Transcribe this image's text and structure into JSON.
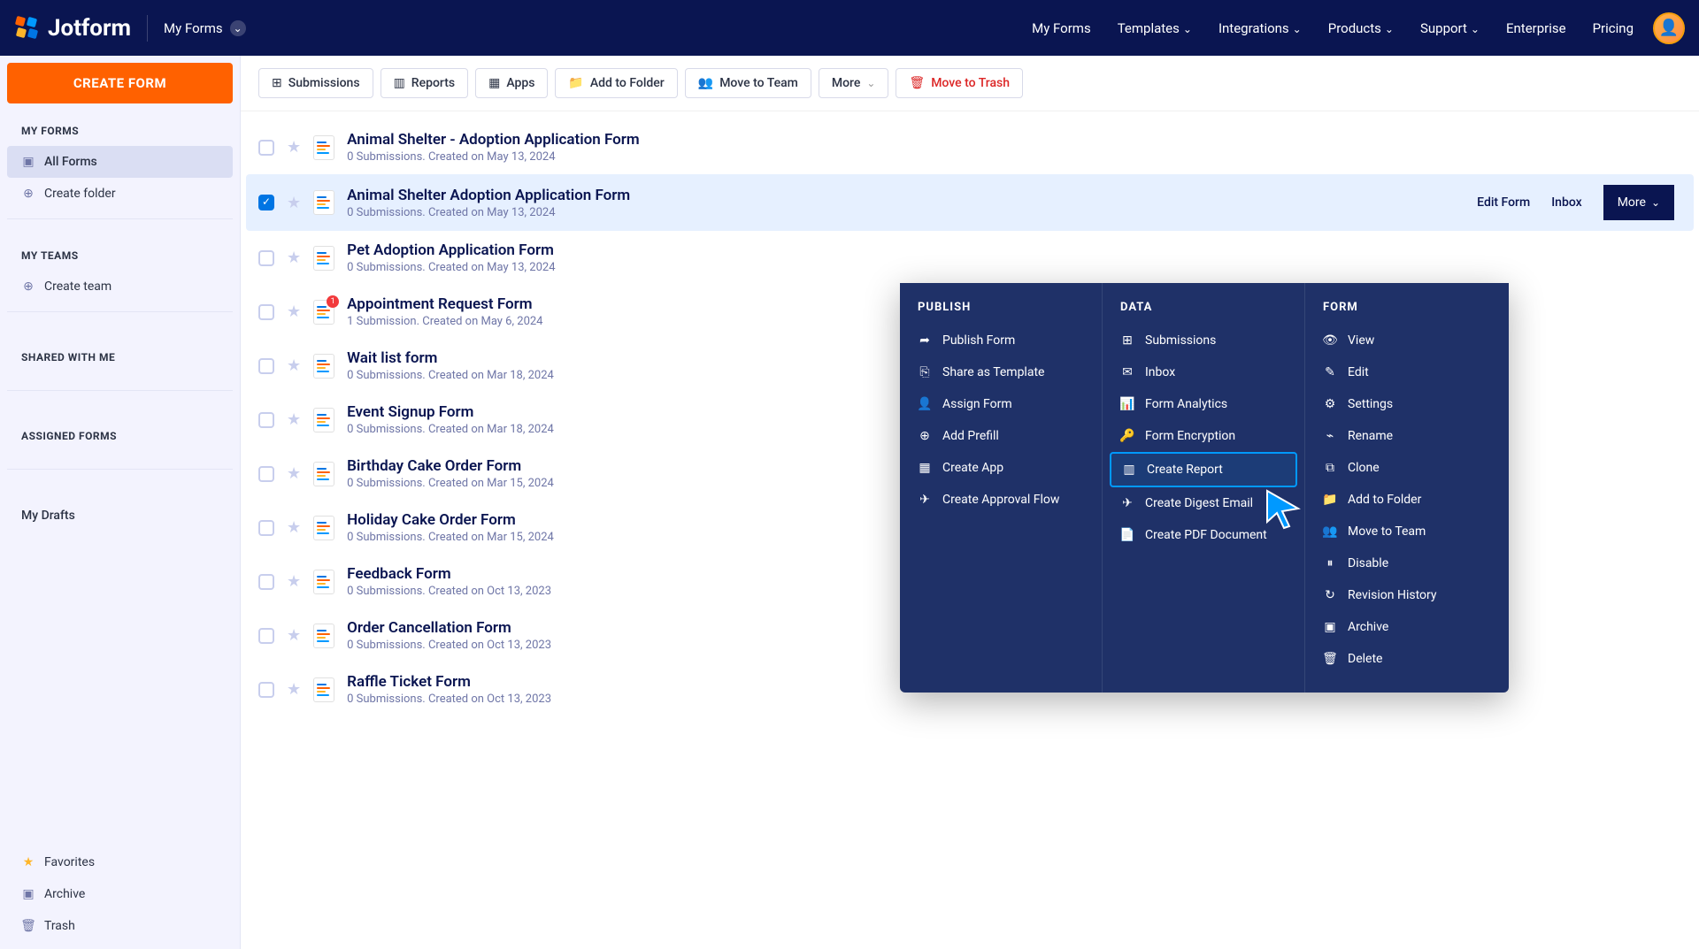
{
  "header": {
    "logo_text": "Jotform",
    "workspace": "My Forms",
    "nav": [
      "My Forms",
      "Templates",
      "Integrations",
      "Products",
      "Support",
      "Enterprise",
      "Pricing"
    ]
  },
  "sidebar": {
    "create_btn": "CREATE FORM",
    "sections": {
      "my_forms": {
        "title": "MY FORMS",
        "all_forms": "All Forms",
        "create_folder": "Create folder"
      },
      "my_teams": {
        "title": "MY TEAMS",
        "create_team": "Create team"
      },
      "shared": {
        "title": "SHARED WITH ME"
      },
      "assigned": {
        "title": "ASSIGNED FORMS"
      },
      "drafts": {
        "title": "My Drafts"
      }
    },
    "bottom": {
      "favorites": "Favorites",
      "archive": "Archive",
      "trash": "Trash"
    }
  },
  "toolbar": {
    "submissions": "Submissions",
    "reports": "Reports",
    "apps": "Apps",
    "add_folder": "Add to Folder",
    "move_team": "Move to Team",
    "more": "More",
    "move_trash": "Move to Trash"
  },
  "forms": [
    {
      "title": "Animal Shelter - Adoption Application Form",
      "meta": "0 Submissions. Created on May 13, 2024",
      "selected": false,
      "badge": null
    },
    {
      "title": "Animal Shelter Adoption Application Form",
      "meta": "0 Submissions. Created on May 13, 2024",
      "selected": true,
      "badge": null
    },
    {
      "title": "Pet Adoption Application Form",
      "meta": "0 Submissions. Created on May 13, 2024",
      "selected": false,
      "badge": null
    },
    {
      "title": "Appointment Request Form",
      "meta": "1 Submission. Created on May 6, 2024",
      "selected": false,
      "badge": "1"
    },
    {
      "title": "Wait list form",
      "meta": "0 Submissions. Created on Mar 18, 2024",
      "selected": false,
      "badge": null
    },
    {
      "title": "Event Signup Form",
      "meta": "0 Submissions. Created on Mar 18, 2024",
      "selected": false,
      "badge": null
    },
    {
      "title": "Birthday Cake Order Form",
      "meta": "0 Submissions. Created on Mar 15, 2024",
      "selected": false,
      "badge": null
    },
    {
      "title": "Holiday Cake Order Form",
      "meta": "0 Submissions. Created on Mar 15, 2024",
      "selected": false,
      "badge": null
    },
    {
      "title": "Feedback Form",
      "meta": "0 Submissions. Created on Oct 13, 2023",
      "selected": false,
      "badge": null
    },
    {
      "title": "Order Cancellation Form",
      "meta": "0 Submissions. Created on Oct 13, 2023",
      "selected": false,
      "badge": null
    },
    {
      "title": "Raffle Ticket Form",
      "meta": "0 Submissions. Created on Oct 13, 2023",
      "selected": false,
      "badge": null
    }
  ],
  "row_actions": {
    "edit": "Edit Form",
    "inbox": "Inbox",
    "more": "More"
  },
  "dropdown": {
    "publish": {
      "title": "PUBLISH",
      "items": [
        "Publish Form",
        "Share as Template",
        "Assign Form",
        "Add Prefill",
        "Create App",
        "Create Approval Flow"
      ]
    },
    "data": {
      "title": "DATA",
      "items": [
        "Submissions",
        "Inbox",
        "Form Analytics",
        "Form Encryption",
        "Create Report",
        "Create Digest Email",
        "Create PDF Document"
      ],
      "highlighted": 4
    },
    "form": {
      "title": "FORM",
      "items": [
        "View",
        "Edit",
        "Settings",
        "Rename",
        "Clone",
        "Add to Folder",
        "Move to Team",
        "Disable",
        "Revision History",
        "Archive",
        "Delete"
      ]
    }
  }
}
